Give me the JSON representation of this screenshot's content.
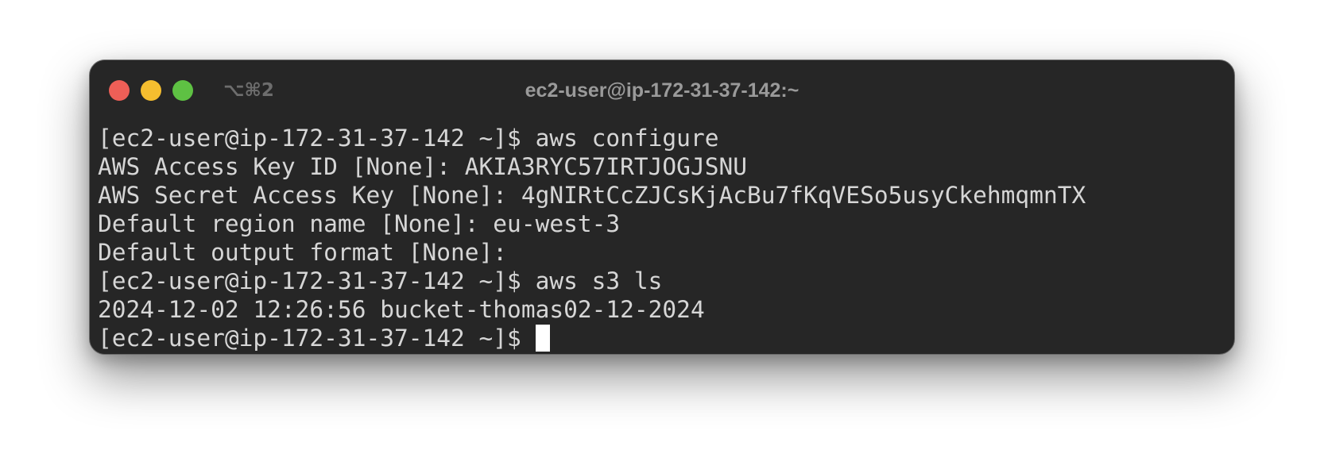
{
  "window": {
    "title": "ec2-user@ip-172-31-37-142:~",
    "tab_shortcut": "⌥⌘2",
    "buttons": {
      "close_color": "#ee5f57",
      "minimize_color": "#f6be2f",
      "zoom_color": "#5ec143"
    }
  },
  "terminal": {
    "lines": [
      "[ec2-user@ip-172-31-37-142 ~]$ aws configure",
      "AWS Access Key ID [None]: AKIA3RYC57IRTJOGJSNU",
      "AWS Secret Access Key [None]: 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",
      "Default region name [None]: eu-west-3",
      "Default output format [None]:",
      "[ec2-user@ip-172-31-37-142 ~]$ aws s3 ls",
      "2024-12-02 12:26:56 bucket-thomas02-12-2024"
    ],
    "prompt": "[ec2-user@ip-172-31-37-142 ~]$"
  }
}
